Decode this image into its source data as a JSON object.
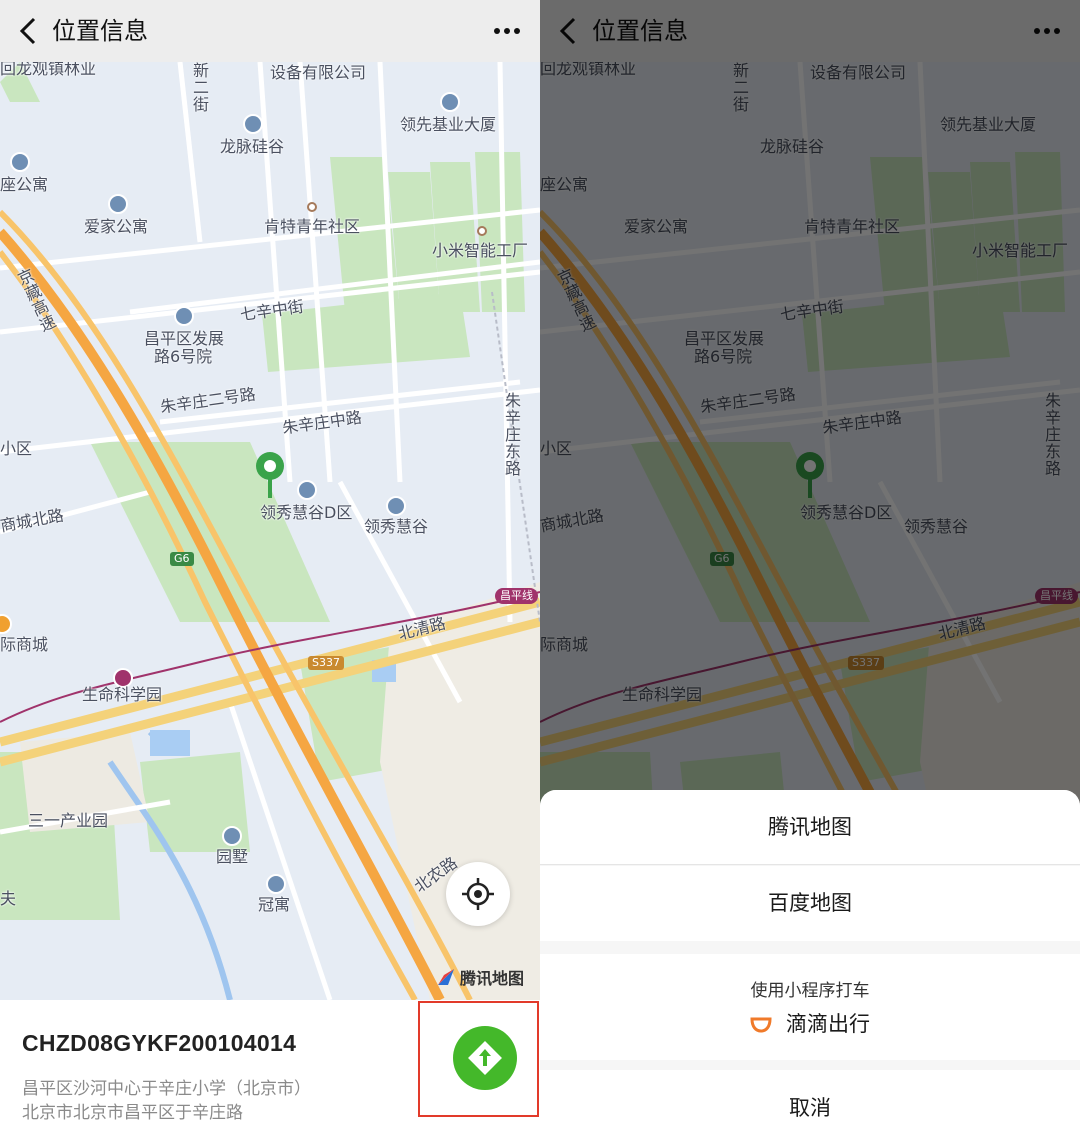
{
  "header": {
    "title": "位置信息"
  },
  "map": {
    "labels": {
      "huilongguan": "回龙观镇林业",
      "shebei": "设备有限公司",
      "xinerjie": "新二街",
      "lingxian": "领先基业大厦",
      "longmai": "龙脉硅谷",
      "zuogongyu": "座公寓",
      "aijia": "爱家公寓",
      "kente": "肯特青年社区",
      "xiaomi": "小米智能工厂",
      "jingzang": "京藏高速",
      "qixin": "七辛中街",
      "changping": "昌平区发展",
      "changping2": "路6号院",
      "zhuxin2": "朱辛庄二号路",
      "zhuxinzhong": "朱辛庄中路",
      "zhuxindong": "朱辛庄东路",
      "xiaoqu": "小区",
      "lingxiud": "领秀慧谷D区",
      "lingxiu": "领秀慧谷",
      "shangcheng": "商城北路",
      "jishangcheng": "际商城",
      "shengming": "生命科学园",
      "beiqing": "北清路",
      "sanyi": "三一产业园",
      "yuanshu": "园墅",
      "guanyu": "冠寓",
      "beinong": "北农路",
      "fu": "夫"
    },
    "shields": {
      "g6": "G6",
      "s337": "S337"
    },
    "metro": "昌平线",
    "provider": "腾讯地图"
  },
  "location": {
    "code": "CHZD08GYKF200104014",
    "address_line1": "昌平区沙河中心于辛庄小学（北京市）",
    "address_line2": "北京市北京市昌平区于辛庄路"
  },
  "sheet": {
    "options": [
      "腾讯地图",
      "百度地图"
    ],
    "taxi_hint": "使用小程序打车",
    "taxi_app": "滴滴出行",
    "cancel": "取消"
  },
  "colors": {
    "accent_green": "#44b82a",
    "highlight_red": "#e23a2a",
    "didi_orange": "#f07a2a"
  }
}
